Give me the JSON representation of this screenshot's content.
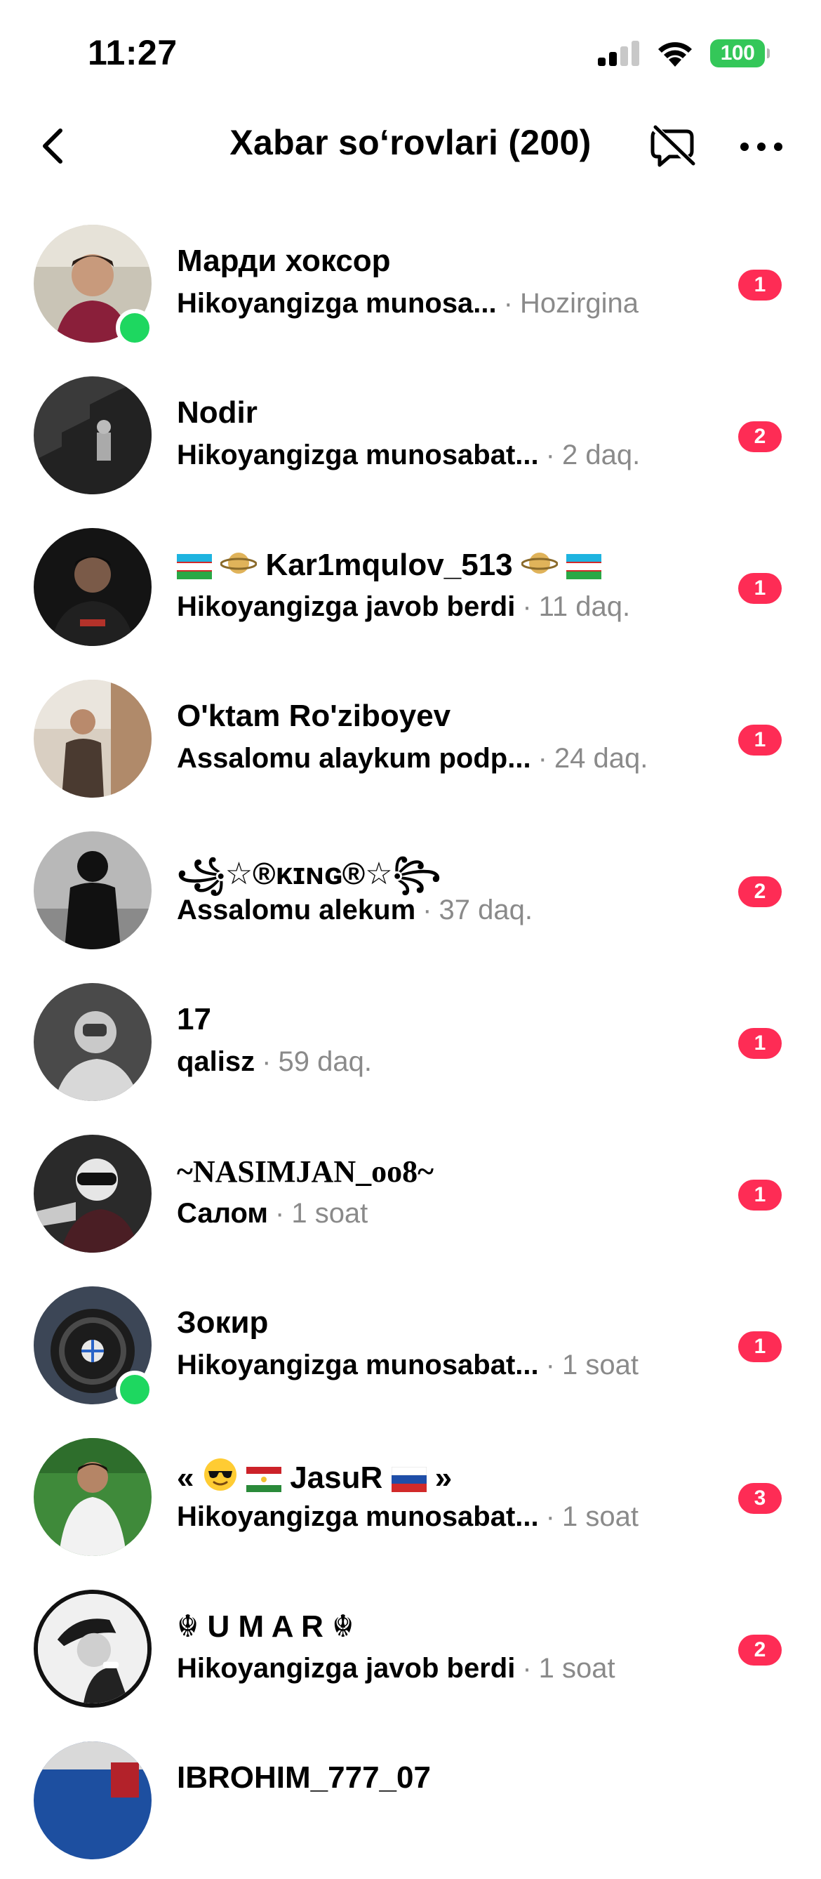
{
  "status_bar": {
    "time": "11:27",
    "battery": "100",
    "icons": [
      "signal-icon",
      "wifi-icon",
      "battery-icon"
    ]
  },
  "header": {
    "title": "Xabar so‘rovlari (200)",
    "icons": [
      "back-arrow-icon",
      "message-filter-icon",
      "more-horizontal-icon"
    ]
  },
  "colors": {
    "badge": "#fe2c55",
    "online": "#1ed760",
    "battery": "#34c759",
    "secondary_text": "#8a8a8a"
  },
  "requests": [
    {
      "name": "Марди хоксор",
      "message": "Hikoyangizga munosa...",
      "time": "Hozirgina",
      "badge": "1",
      "online": true
    },
    {
      "name": "Nodir",
      "message": "Hikoyangizga munosabat...",
      "time": "2 daq.",
      "badge": "2",
      "online": false
    },
    {
      "name": "Kar1mqulov_513",
      "message": "Hikoyangizga javob berdi",
      "time": "11 daq.",
      "badge": "1",
      "online": false
    },
    {
      "name": "O'ktam Ro'ziboyev",
      "message": "Assalomu alaykum podp...",
      "time": "24 daq.",
      "badge": "1",
      "online": false
    },
    {
      "name": "꧁☆®ᴋɪɴɢ®☆꧂",
      "message": "Assalomu alekum",
      "time": "37 daq.",
      "badge": "2",
      "online": false
    },
    {
      "name": "17",
      "message": "qalisz",
      "time": "59 daq.",
      "badge": "1",
      "online": false
    },
    {
      "name": "~NASIMJAN_oo8~",
      "message": "Салом",
      "time": "1 soat",
      "badge": "1",
      "online": false
    },
    {
      "name": "Зокир",
      "message": "Hikoyangizga munosabat...",
      "time": "1 soat",
      "badge": "1",
      "online": true
    },
    {
      "name": "«",
      "name_mid": "JasuR",
      "name_end": "»",
      "message": "Hikoyangizga munosabat...",
      "time": "1 soat",
      "badge": "3",
      "online": false
    },
    {
      "name": "☬ U M A R ☬",
      "message": "Hikoyangizga javob berdi",
      "time": "1 soat",
      "badge": "2",
      "online": false
    },
    {
      "name": "IBROHIM_777_07",
      "message": "",
      "time": "",
      "badge": "",
      "online": false
    }
  ]
}
